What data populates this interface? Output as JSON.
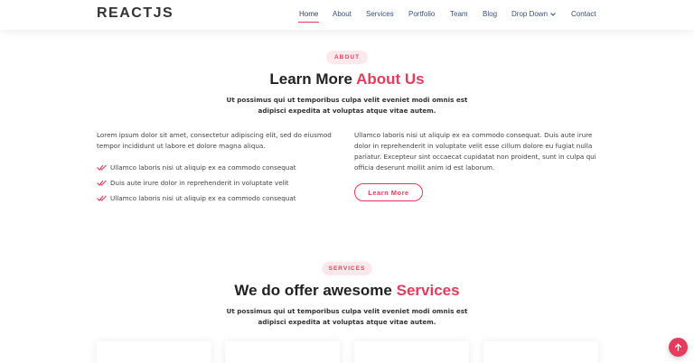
{
  "header": {
    "logo": "REACTJS",
    "nav": [
      {
        "label": "Home",
        "active": true
      },
      {
        "label": "About"
      },
      {
        "label": "Services"
      },
      {
        "label": "Portfolio"
      },
      {
        "label": "Team"
      },
      {
        "label": "Blog"
      },
      {
        "label": "Drop Down",
        "has_dropdown": true
      },
      {
        "label": "Contact"
      }
    ]
  },
  "about": {
    "badge": "ABOUT",
    "title_plain": "Learn More ",
    "title_accent": "About Us",
    "subtitle": "Ut possimus qui ut temporibus culpa velit eveniet modi omnis est adipisci expedita at voluptas atque vitae autem.",
    "left_paragraph": "Lorem ipsum dolor sit amet, consectetur adipiscing elit, sed do eiusmod tempor incididunt ut labore et dolore magna aliqua.",
    "checklist": [
      "Ullamco laboris nisi ut aliquip ex ea commodo consequat",
      "Duis aute irure dolor in reprehenderit in voluptate velit",
      "Ullamco laboris nisi ut aliquip ex ea commodo consequat"
    ],
    "right_paragraph": "Ullamco laboris nisi ut aliquip ex ea commodo consequat. Duis aute irure dolor in reprehenderit in voluptate velit esse cillum dolore eu fugiat nulla pariatur. Excepteur sint occaecat cupidatat non proident, sunt in culpa qui officia deserunt mollit anim id est laborum.",
    "button_label": "Learn More"
  },
  "services": {
    "badge": "SERVICES",
    "title_plain": "We do offer awesome ",
    "title_accent": "Services",
    "subtitle": "Ut possimus qui ut temporibus culpa velit eveniet modi omnis est adipisci expedita at voluptas atque vitae autem."
  },
  "icons": {
    "check": "double-check-icon",
    "back_to_top": "arrow-up-icon",
    "dropdown": "chevron-down-icon"
  },
  "colors": {
    "accent": "#e43c5c",
    "badge_bg": "#fde9ec",
    "nav_text": "#37517e",
    "heading": "#222222"
  }
}
